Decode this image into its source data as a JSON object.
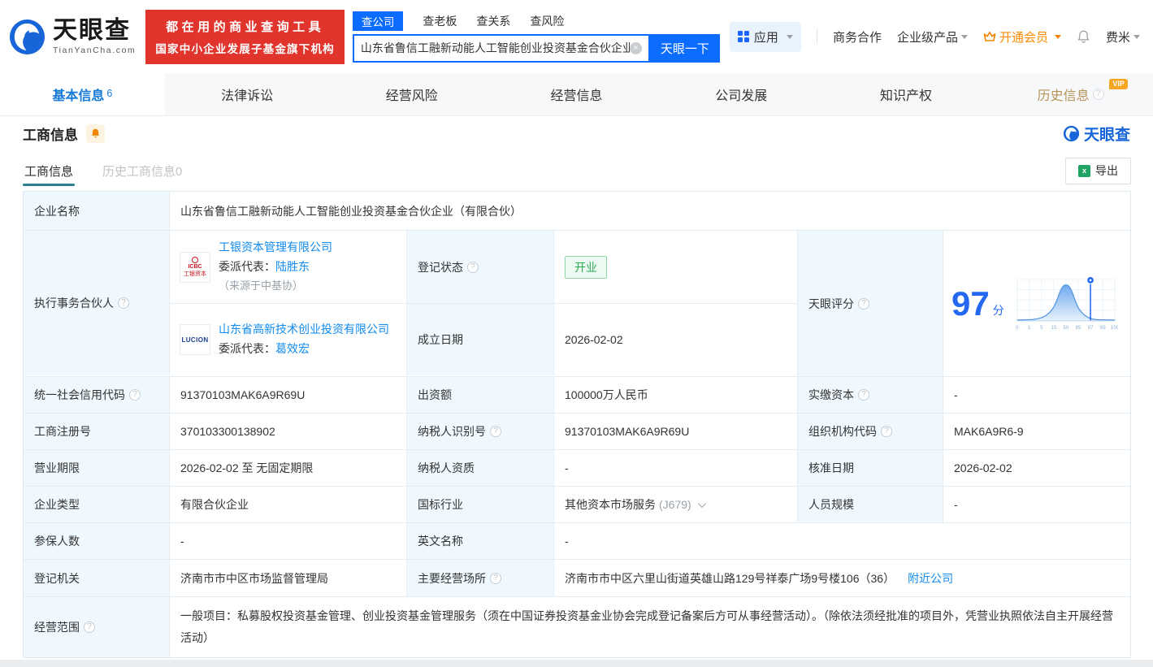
{
  "brand": {
    "name": "天眼查",
    "domain": "TianYanCha.com",
    "banner_line1": "都在用的商业查询工具",
    "banner_line2": "国家中小企业发展子基金旗下机构"
  },
  "search": {
    "tabs": [
      {
        "label": "查公司",
        "active": true
      },
      {
        "label": "查老板"
      },
      {
        "label": "查关系"
      },
      {
        "label": "查风险"
      }
    ],
    "value": "山东省鲁信工融新动能人工智能创业投资基金合伙企业",
    "button": "天眼一下"
  },
  "topnav": {
    "apps": "应用",
    "business_cooperation": "商务合作",
    "enterprise_products": "企业级产品",
    "vip": "开通会员",
    "username": "费米"
  },
  "tabs": [
    {
      "label": "基本信息",
      "count": "6"
    },
    {
      "label": "法律诉讼"
    },
    {
      "label": "经营风险"
    },
    {
      "label": "经营信息"
    },
    {
      "label": "公司发展"
    },
    {
      "label": "知识产权"
    },
    {
      "label": "历史信息",
      "vip": "VIP"
    }
  ],
  "section": {
    "title": "工商信息",
    "watermark": "天眼查"
  },
  "subtabs": {
    "current": "工商信息",
    "history": "历史工商信息0",
    "export": "导出"
  },
  "icons": {
    "question": "?",
    "clear": "×",
    "excel": "x"
  },
  "table": {
    "company_name": {
      "label": "企业名称",
      "value": "山东省鲁信工融新动能人工智能创业投资基金合伙企业（有限合伙）"
    },
    "partners": {
      "label": "执行事务合伙人",
      "items": [
        {
          "logo_mark": "ICBC",
          "logo_sub": "工银资本",
          "name": "工银资本管理有限公司",
          "rep_label": "委派代表：",
          "rep_name": "陆胜东",
          "rep_note": "（来源于中基协）"
        },
        {
          "logo_mark": "LUCION",
          "logo_sub": "",
          "name": "山东省高新技术创业投资有限公司",
          "rep_label": "委派代表：",
          "rep_name": "葛效宏",
          "rep_note": ""
        }
      ]
    },
    "reg_status": {
      "label": "登记状态",
      "value": "开业"
    },
    "establish_date": {
      "label": "成立日期",
      "value": "2026-02-02"
    },
    "tyc_score": {
      "label": "天眼评分",
      "value": "97",
      "unit": "分",
      "axis_ticks": [
        "0",
        "1",
        "5",
        "15",
        "50",
        "85",
        "97",
        "99",
        "100"
      ],
      "marker_value": "97"
    },
    "credit_code": {
      "label": "统一社会信用代码",
      "value": "91370103MAK6A9R69U"
    },
    "contributed_capital": {
      "label": "出资额",
      "value": "100000万人民币"
    },
    "paid_in_capital": {
      "label": "实缴资本",
      "value": "-"
    },
    "reg_number": {
      "label": "工商注册号",
      "value": "370103300138902"
    },
    "taxpayer_id": {
      "label": "纳税人识别号",
      "value": "91370103MAK6A9R69U"
    },
    "org_code": {
      "label": "组织机构代码",
      "value": "MAK6A9R6-9"
    },
    "business_term": {
      "label": "营业期限",
      "value": "2026-02-02 至 无固定期限"
    },
    "taxpayer_qualification": {
      "label": "纳税人资质",
      "value": "-"
    },
    "approval_date": {
      "label": "核准日期",
      "value": "2026-02-02"
    },
    "company_type": {
      "label": "企业类型",
      "value": "有限合伙企业"
    },
    "industry": {
      "label": "国标行业",
      "value": "其他资本市场服务",
      "code": "(J679)"
    },
    "staff_size": {
      "label": "人员规模",
      "value": "-"
    },
    "insured_count": {
      "label": "参保人数",
      "value": "-"
    },
    "english_name": {
      "label": "英文名称",
      "value": "-"
    },
    "reg_authority": {
      "label": "登记机关",
      "value": "济南市市中区市场监督管理局"
    },
    "main_premises": {
      "label": "主要经营场所",
      "value": "济南市市中区六里山街道英雄山路129号祥泰广场9号楼106（36）",
      "nearby_link": "附近公司"
    },
    "business_scope": {
      "label": "经营范围",
      "value": "一般项目：私募股权投资基金管理、创业投资基金管理服务（须在中国证券投资基金业协会完成登记备案后方可从事经营活动）。（除依法须经批准的项目外，凭营业执照依法自主开展经营活动）"
    }
  },
  "colors": {
    "brand_blue": "#0b6cff",
    "link_blue": "#128bed",
    "banner_red": "#e0342c",
    "status_green": "#2cab52",
    "vip_orange": "#f5a623",
    "history_gold": "#b69358",
    "score_blue": "#2468f2",
    "label_cell_bg": "#eff8fe"
  }
}
